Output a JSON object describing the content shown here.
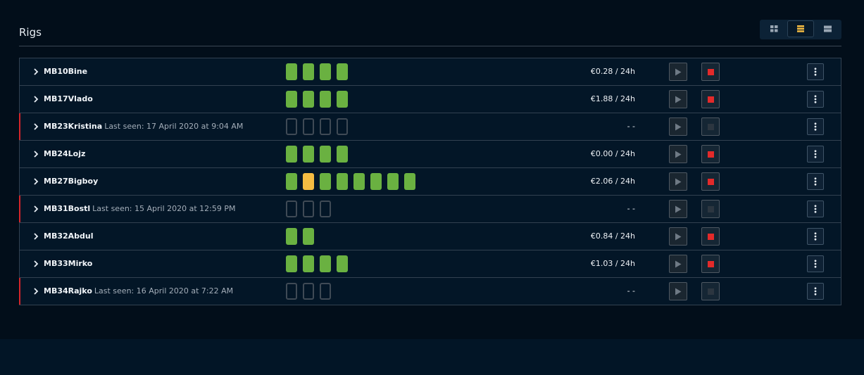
{
  "page": {
    "title": "Rigs"
  },
  "view_toggle": {
    "options": [
      "grid-view-icon",
      "compact-list-view-icon",
      "list-view-icon"
    ],
    "active_index": 1,
    "active_color": "#f5bc42"
  },
  "colors": {
    "gpu_ok": "#6ab141",
    "gpu_warn": "#f5bc42",
    "stop_active": "#e32a2a",
    "offline_marker": "#d4252b"
  },
  "rigs": [
    {
      "name": "MB10Bine",
      "last_seen": "",
      "offline": false,
      "gpus": [
        "ok",
        "ok",
        "ok",
        "ok"
      ],
      "profit": "€0.28 / 24h"
    },
    {
      "name": "MB17Vlado",
      "last_seen": "",
      "offline": false,
      "gpus": [
        "ok",
        "ok",
        "ok",
        "ok"
      ],
      "profit": "€1.88 / 24h"
    },
    {
      "name": "MB23Kristina",
      "last_seen": "Last seen: 17 April 2020 at 9:04 AM",
      "offline": true,
      "gpus": [
        "off",
        "off",
        "off",
        "off"
      ],
      "profit": "- -"
    },
    {
      "name": "MB24Lojz",
      "last_seen": "",
      "offline": false,
      "gpus": [
        "ok",
        "ok",
        "ok",
        "ok"
      ],
      "profit": "€0.00 / 24h"
    },
    {
      "name": "MB27Bigboy",
      "last_seen": "",
      "offline": false,
      "gpus": [
        "ok",
        "warn",
        "ok",
        "ok",
        "ok",
        "ok",
        "ok",
        "ok"
      ],
      "profit": "€2.06 / 24h"
    },
    {
      "name": "MB31Bostl",
      "last_seen": "Last seen: 15 April 2020 at 12:59 PM",
      "offline": true,
      "gpus": [
        "off",
        "off",
        "off"
      ],
      "profit": "- -"
    },
    {
      "name": "MB32Abdul",
      "last_seen": "",
      "offline": false,
      "gpus": [
        "ok",
        "ok"
      ],
      "profit": "€0.84 / 24h"
    },
    {
      "name": "MB33Mirko",
      "last_seen": "",
      "offline": false,
      "gpus": [
        "ok",
        "ok",
        "ok",
        "ok"
      ],
      "profit": "€1.03 / 24h"
    },
    {
      "name": "MB34Rajko",
      "last_seen": "Last seen: 16 April 2020 at 7:22 AM",
      "offline": true,
      "gpus": [
        "off",
        "off",
        "off"
      ],
      "profit": "- -"
    }
  ]
}
